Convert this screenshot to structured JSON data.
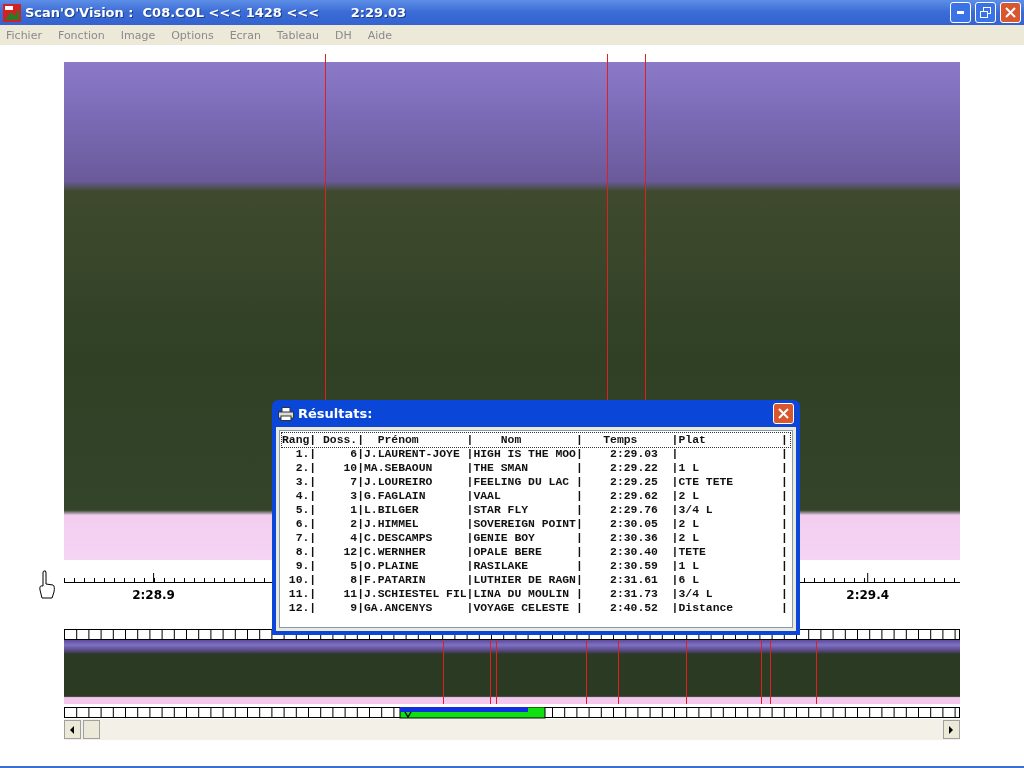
{
  "window": {
    "title": "Scan'O'Vision :  C08.COL <<< 1428 <<<       2:29.03"
  },
  "menu": [
    "Fichier",
    "Fonction",
    "Image",
    "Options",
    "Ecran",
    "Tableau",
    "DH",
    "Aide"
  ],
  "ruler": {
    "labels": [
      "2:28.9",
      "2:29.4"
    ]
  },
  "results": {
    "title": "Résultats:",
    "header": "Rang| Doss.|  Prénom       |    Nom        |   Temps     |Plat           |",
    "lines": [
      "  1.|     6|J.LAURENT-JOYE |HIGH IS THE MOO|    2:29.03  |               |",
      "  2.|    10|MA.SEBAOUN     |THE SMAN       |    2:29.22  |1 L            |",
      "  3.|     7|J.LOUREIRO     |FEELING DU LAC |    2:29.25  |CTE TETE       |",
      "  4.|     3|G.FAGLAIN      |VAAL           |    2:29.62  |2 L            |",
      "  5.|     1|L.BILGER       |STAR FLY       |    2:29.76  |3/4 L          |",
      "  6.|     2|J.HIMMEL       |SOVEREIGN POINT|    2:30.05  |2 L            |",
      "  7.|     4|C.DESCAMPS     |GENIE BOY      |    2:30.36  |2 L            |",
      "  8.|    12|C.WERNHER      |OPALE BERE     |    2:30.40  |TETE           |",
      "  9.|     5|O.PLAINE       |RASILAKE       |    2:30.59  |1 L            |",
      " 10.|     8|F.PATARIN      |LUTHIER DE RAGN|    2:31.61  |6 L            |",
      " 11.|    11|J.SCHIESTEL FIL|LINA DU MOULIN |    2:31.73  |3/4 L          |",
      " 12.|     9|GA.ANCENYS     |VOYAGE CELESTE |    2:40.52  |Distance       |"
    ]
  }
}
